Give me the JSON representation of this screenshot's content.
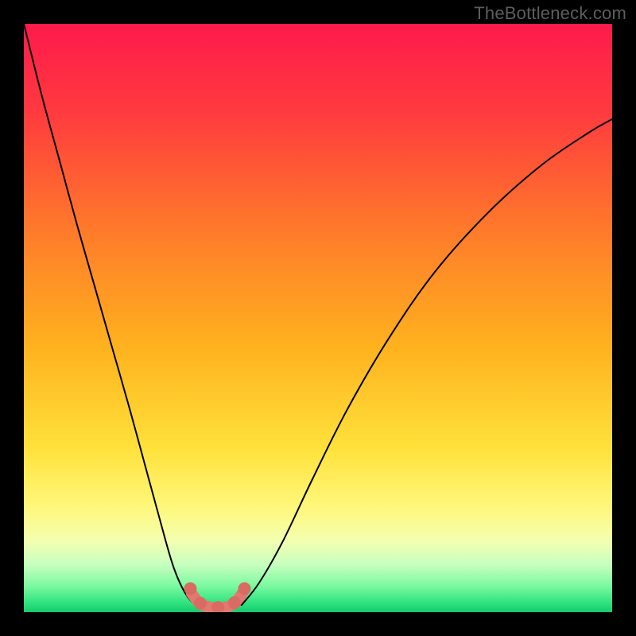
{
  "watermark": "TheBottleneck.com",
  "chart_data": {
    "type": "line",
    "title": "",
    "xlabel": "",
    "ylabel": "",
    "xlim": [
      0,
      1
    ],
    "ylim": [
      0,
      1
    ],
    "gradient_stops": [
      {
        "offset": 0.0,
        "color": "#ff1a4b"
      },
      {
        "offset": 0.15,
        "color": "#ff3a3f"
      },
      {
        "offset": 0.35,
        "color": "#ff7a2a"
      },
      {
        "offset": 0.55,
        "color": "#ffb21e"
      },
      {
        "offset": 0.72,
        "color": "#ffe13a"
      },
      {
        "offset": 0.82,
        "color": "#fff77a"
      },
      {
        "offset": 0.88,
        "color": "#f3ffb0"
      },
      {
        "offset": 0.92,
        "color": "#c6ffbf"
      },
      {
        "offset": 0.955,
        "color": "#7cf9a0"
      },
      {
        "offset": 0.985,
        "color": "#2de27e"
      },
      {
        "offset": 1.0,
        "color": "#17c96e"
      }
    ],
    "series": [
      {
        "name": "bottleneck-curve-left",
        "color": "#000000",
        "width": 2.0,
        "x": [
          0.0,
          0.03,
          0.06,
          0.09,
          0.12,
          0.15,
          0.18,
          0.21,
          0.24,
          0.255,
          0.27,
          0.285,
          0.3
        ],
        "values": [
          1.0,
          0.88,
          0.77,
          0.66,
          0.555,
          0.45,
          0.345,
          0.235,
          0.125,
          0.075,
          0.04,
          0.018,
          0.01
        ]
      },
      {
        "name": "bottleneck-curve-right",
        "color": "#000000",
        "width": 2.0,
        "x": [
          0.37,
          0.4,
          0.44,
          0.49,
          0.55,
          0.62,
          0.7,
          0.79,
          0.88,
          0.96,
          1.0
        ],
        "values": [
          0.012,
          0.05,
          0.12,
          0.225,
          0.345,
          0.465,
          0.58,
          0.68,
          0.76,
          0.815,
          0.838
        ]
      },
      {
        "name": "bottleneck-valley-highlight",
        "color": "#e2786f",
        "width": 14,
        "x": [
          0.285,
          0.3,
          0.32,
          0.34,
          0.358,
          0.372
        ],
        "values": [
          0.032,
          0.014,
          0.008,
          0.008,
          0.015,
          0.033
        ]
      }
    ],
    "valley_markers": {
      "color": "#d96b63",
      "radius": 8,
      "points": [
        {
          "x": 0.283,
          "y": 0.04
        },
        {
          "x": 0.3,
          "y": 0.015
        },
        {
          "x": 0.33,
          "y": 0.008
        },
        {
          "x": 0.358,
          "y": 0.016
        },
        {
          "x": 0.375,
          "y": 0.04
        }
      ]
    }
  }
}
